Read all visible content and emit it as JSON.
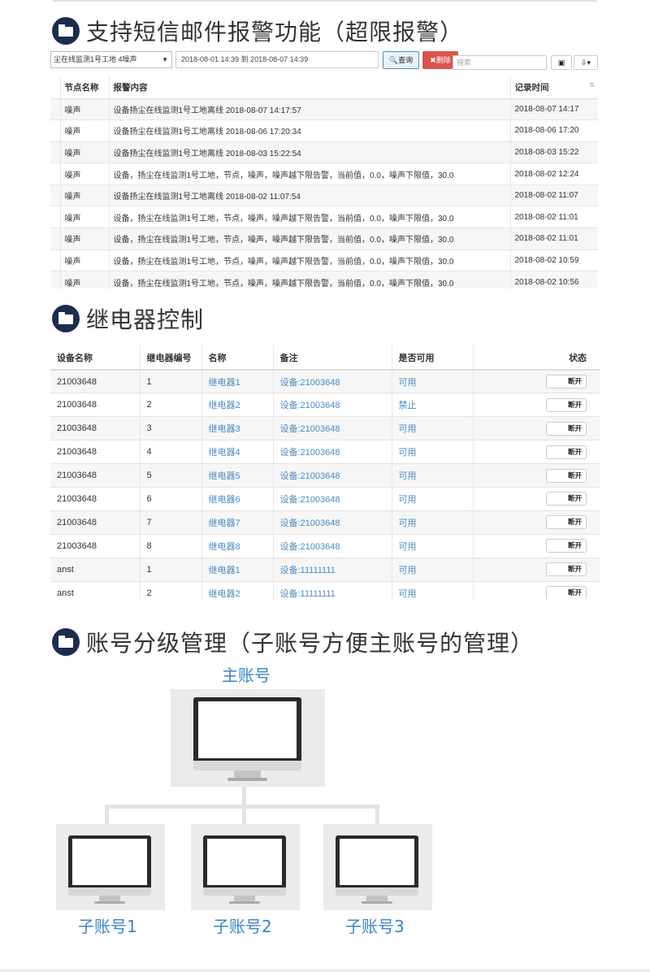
{
  "section1": {
    "title": "支持短信邮件报警功能（超限报警）",
    "toolbar": {
      "device_select": "尘在线监测1号工地 4噪声",
      "date_range": "2018-08-01 14:39 到 2018-08-07 14:39",
      "query_label": "查询",
      "delete_label": "删除",
      "search_placeholder": "搜索"
    },
    "columns": [
      "节点名称",
      "报警内容",
      "记录时间"
    ],
    "rows": [
      {
        "node": "噪声",
        "content": "设备扬尘在线监测1号工地离线 2018-08-07 14:17:57",
        "time": "2018-08-07 14:17"
      },
      {
        "node": "噪声",
        "content": "设备扬尘在线监测1号工地离线 2018-08-06 17:20:34",
        "time": "2018-08-06 17:20"
      },
      {
        "node": "噪声",
        "content": "设备扬尘在线监测1号工地离线 2018-08-03 15:22:54",
        "time": "2018-08-03 15:22"
      },
      {
        "node": "噪声",
        "content": "设备，扬尘在线监测1号工地，节点，噪声，噪声越下限告警，当前值，0.0，噪声下限值，30.0",
        "time": "2018-08-02 12:24"
      },
      {
        "node": "噪声",
        "content": "设备扬尘在线监测1号工地离线 2018-08-02 11:07:54",
        "time": "2018-08-02 11:07"
      },
      {
        "node": "噪声",
        "content": "设备，扬尘在线监测1号工地，节点，噪声，噪声越下限告警，当前值，0.0，噪声下限值，30.0",
        "time": "2018-08-02 11:01"
      },
      {
        "node": "噪声",
        "content": "设备，扬尘在线监测1号工地，节点，噪声，噪声越下限告警，当前值，0.0，噪声下限值，30.0",
        "time": "2018-08-02 11:01"
      },
      {
        "node": "噪声",
        "content": "设备，扬尘在线监测1号工地，节点，噪声，噪声越下限告警，当前值，0.0，噪声下限值，30.0",
        "time": "2018-08-02 10:59"
      },
      {
        "node": "噪声",
        "content": "设备，扬尘在线监测1号工地，节点，噪声，噪声越下限告警，当前值，0.0，噪声下限值，30.0",
        "time": "2018-08-02 10:56"
      }
    ]
  },
  "section2": {
    "title": "继电器控制",
    "columns": [
      "设备名称",
      "继电器编号",
      "名称",
      "备注",
      "是否可用",
      "状态"
    ],
    "button_label": "断开",
    "rows": [
      {
        "device": "21003648",
        "no": "1",
        "name": "继电器1",
        "note": "设备:21003648",
        "avail": "可用"
      },
      {
        "device": "21003648",
        "no": "2",
        "name": "继电器2",
        "note": "设备:21003648",
        "avail": "禁止"
      },
      {
        "device": "21003648",
        "no": "3",
        "name": "继电器3",
        "note": "设备:21003648",
        "avail": "可用"
      },
      {
        "device": "21003648",
        "no": "4",
        "name": "继电器4",
        "note": "设备:21003648",
        "avail": "可用"
      },
      {
        "device": "21003648",
        "no": "5",
        "name": "继电器5",
        "note": "设备:21003648",
        "avail": "可用"
      },
      {
        "device": "21003648",
        "no": "6",
        "name": "继电器6",
        "note": "设备:21003648",
        "avail": "可用"
      },
      {
        "device": "21003648",
        "no": "7",
        "name": "继电器7",
        "note": "设备:21003648",
        "avail": "可用"
      },
      {
        "device": "21003648",
        "no": "8",
        "name": "继电器8",
        "note": "设备:21003648",
        "avail": "可用"
      },
      {
        "device": "anst",
        "no": "1",
        "name": "继电器1",
        "note": "设备:11111111",
        "avail": "可用"
      },
      {
        "device": "anst",
        "no": "2",
        "name": "继电器2",
        "note": "设备:11111111",
        "avail": "可用"
      }
    ]
  },
  "section3": {
    "title": "账号分级管理（子账号方便主账号的管理）",
    "main_account": "主账号",
    "sub_accounts": [
      "子账号1",
      "子账号2",
      "子账号3"
    ]
  }
}
